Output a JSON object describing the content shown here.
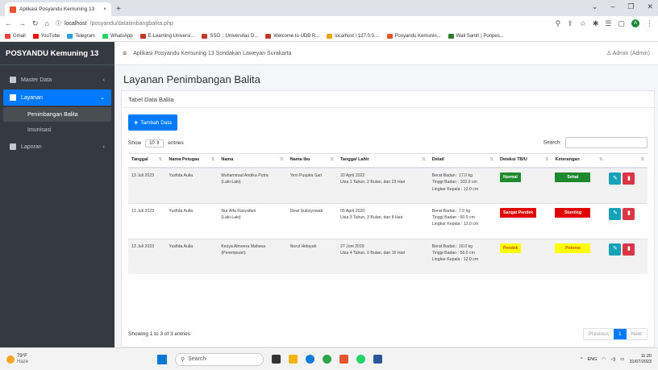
{
  "browser": {
    "tab_title": "Aplikasi Posyandu Kemuning 13",
    "tab_close": "×",
    "new_tab": "+",
    "url_host": "localhost",
    "url_path": "/posyandu/datatimbangbalita.php",
    "bookmarks": [
      {
        "label": "Gmail",
        "color": "#ea4335"
      },
      {
        "label": "YouTube",
        "color": "#ff0000"
      },
      {
        "label": "Telegram",
        "color": "#2aa1da"
      },
      {
        "label": "WhatsApp",
        "color": "#25d366"
      },
      {
        "label": "E-Learning Universi...",
        "color": "#c0392b"
      },
      {
        "label": "SSO :: Universitas D...",
        "color": "#c0392b"
      },
      {
        "label": "Welcome to UDB R...",
        "color": "#c0392b"
      },
      {
        "label": "localhost / 127.0.0....",
        "color": "#f0a30a"
      },
      {
        "label": "Posyandu Kemunin...",
        "color": "#e8542f"
      },
      {
        "label": "Wali Santri | Ponpes...",
        "color": "#2e7d32"
      }
    ],
    "profile_initial": "A"
  },
  "sidebar": {
    "brand": "POSYANDU Kemuning 13",
    "items": [
      {
        "label": "Master Data"
      },
      {
        "label": "Layanan"
      },
      {
        "label": "Laporan"
      }
    ],
    "subitems": [
      {
        "label": "Penimbangan Balita"
      },
      {
        "label": "Imunisasi"
      }
    ]
  },
  "topnav": {
    "app_name": "Aplikasi Posyandu Kemuning 13 Sondakan Laweyan Surakarta",
    "user": "Admin (Admin)"
  },
  "page": {
    "title": "Layanan Penimbangan Balita",
    "card_title": "Tabel Data Balita",
    "add_button": "Tambah Data",
    "show_label": "Show",
    "entries_value": "10",
    "entries_label": "entries",
    "search_label": "Search:",
    "info": "Showing 1 to 3 of 3 entries",
    "prev": "Previous",
    "page_num": "1",
    "next": "Next"
  },
  "table": {
    "headers": [
      "Tanggal",
      "Nama Petugas",
      "Nama",
      "Nama Ibu",
      "Tanggal Lahir",
      "Detail",
      "Deteksi TB/U",
      "Keterangan",
      ""
    ],
    "rows": [
      {
        "tanggal": "13 Juli 2023",
        "petugas": "Yusfida Aulia",
        "nama": "Muhammad Andika Putra",
        "jk": "(Laki-Laki)",
        "ibu": "Yeni Puspita Sari",
        "lahir": "20 April 2022",
        "usia": "Usia 1 Tahun, 2 Bulan, dan 23 Hari",
        "bb": "Berat Badan    : 17.0 kg",
        "tb": "Tinggi Badan   : 102.0 cm",
        "lk": "Lingkar Kepala : 12.0 cm",
        "deteksi": "Normal",
        "keterangan": "Sehat"
      },
      {
        "tanggal": "13 Juli 2023",
        "petugas": "Yusfida Aulia",
        "nama": "Nur Alfa Rasyafani",
        "jk": "(Laki-Laki)",
        "ibu": "Dewi Sulistyowati",
        "lahir": "05 April 2020",
        "usia": "Usia 3 Tahun, 3 Bulan, dan 8 Hari",
        "bb": "Berat Badan    : 7.0 kg",
        "tb": "Tinggi Badan   : 50.0 cm",
        "lk": "Lingkar Kepala : 12.0 cm",
        "deteksi": "Sangat Pendek",
        "keterangan": "Stunting"
      },
      {
        "tanggal": "13 Juli 2023",
        "petugas": "Yusfida Aulia",
        "nama": "Kesya Almeera Mahesa",
        "jk": "(Perempuan)",
        "ibu": "Nurul Hidayah",
        "lahir": "27 Juni 2019",
        "usia": "Usia 4 Tahun, 0 Bulan, dan 16 Hari",
        "bb": "Berat Badan    : 18.0 kg",
        "tb": "Tinggi Badan   : 56.0 cm",
        "lk": "Lingkar Kepala : 12.0 cm",
        "deteksi": "Pendek",
        "keterangan": "Potensi"
      }
    ]
  },
  "taskbar": {
    "temp": "79°F",
    "weather": "Haze",
    "search": "Search",
    "lang": "ENG",
    "time": "11:20",
    "date": "31/07/2023"
  }
}
